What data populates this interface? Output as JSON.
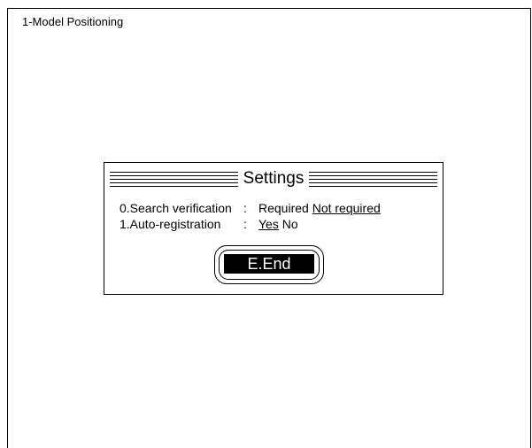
{
  "screen": {
    "title": "1-Model Positioning"
  },
  "dialog": {
    "title": "Settings",
    "settings": [
      {
        "label": "0.Search verification",
        "separator": ":",
        "options": [
          "Required",
          "Not required"
        ],
        "selected": "Not required"
      },
      {
        "label": "1.Auto-registration",
        "separator": ":",
        "options": [
          "Yes",
          "No"
        ],
        "selected": "Yes"
      }
    ],
    "end_button": "E.End"
  }
}
